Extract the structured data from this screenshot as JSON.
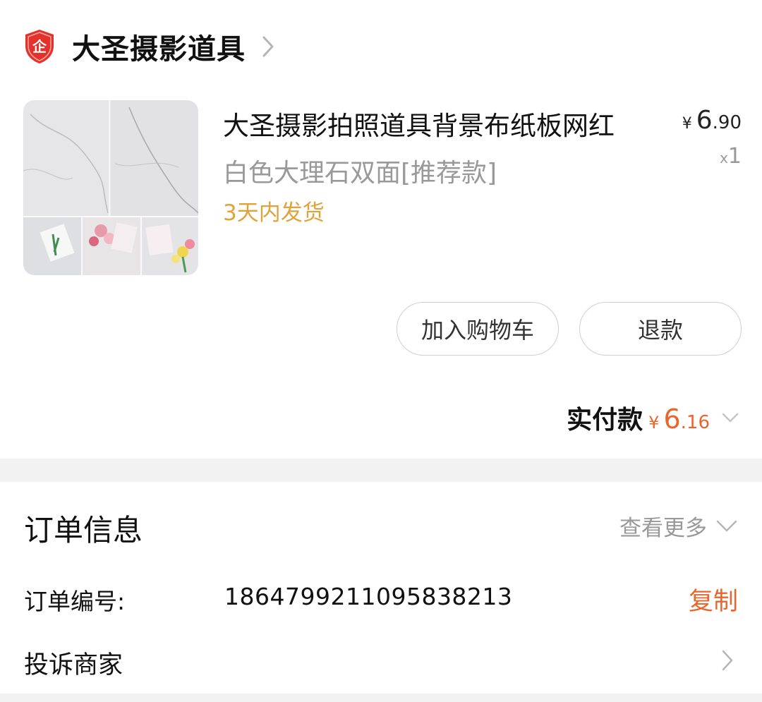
{
  "shop": {
    "name": "大圣摄影道具",
    "badge_text": "企",
    "colors": {
      "badge": "#e4322b"
    }
  },
  "product": {
    "title": "大圣摄影拍照道具背景布纸板网红",
    "spec": "白色大理石双面[推荐款]",
    "shipping": "3天内发货",
    "price": {
      "currency": "¥",
      "integer": "6",
      "decimal": ".90"
    },
    "quantity": {
      "prefix": "x",
      "value": "1"
    },
    "image_icon": "marble-backdrop-image"
  },
  "actions": {
    "add_to_cart": "加入购物车",
    "refund": "退款"
  },
  "payment": {
    "label": "实付款",
    "currency": "¥",
    "integer": "6",
    "decimal": ".16",
    "color": "#e9652c"
  },
  "order_info": {
    "title": "订单信息",
    "more": "查看更多",
    "order_number_label": "订单编号:",
    "order_number": "1864799211095838213",
    "copy": "复制",
    "complain": "投诉商家"
  }
}
